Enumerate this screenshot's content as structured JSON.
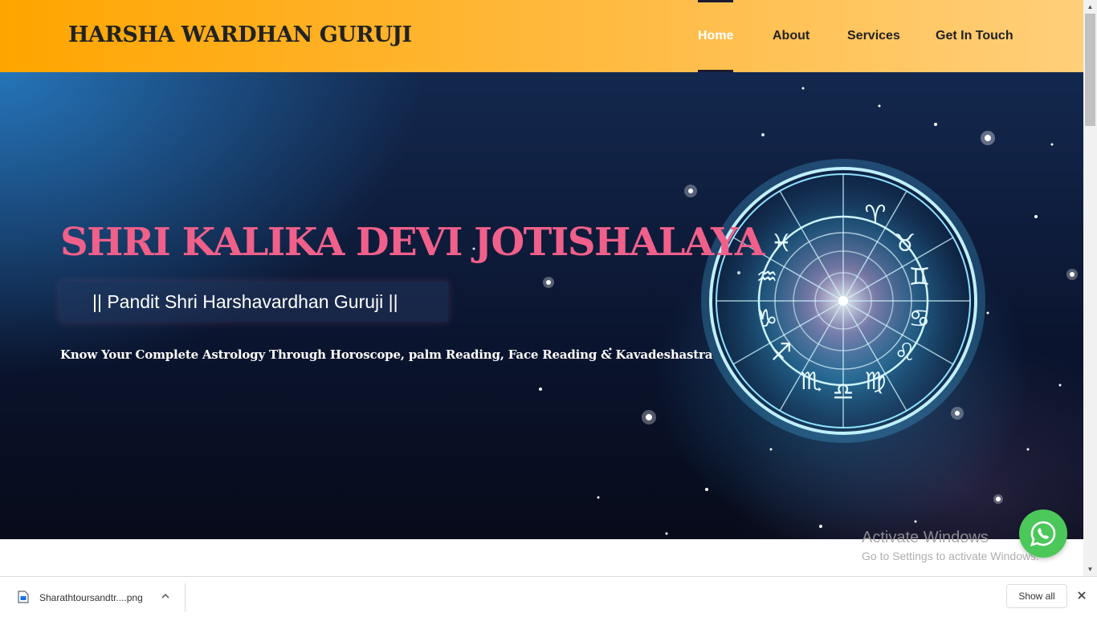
{
  "header": {
    "site_title": "HARSHA WARDHAN GURUJI",
    "nav": [
      "Home",
      "About",
      "Services",
      "Get In Touch"
    ],
    "active_nav": "Home"
  },
  "hero": {
    "title": "SHRI KALIKA DEVI JOTISHALAYA",
    "subtitle": "|| Pandit Shri Harshavardhan Guruji ||",
    "description": "Know Your Complete Astrology Through Horoscope, palm Reading, Face Reading & Kavadeshastra"
  },
  "watermark": {
    "title": "Activate Windows",
    "subtitle": "Go to Settings to activate Windows."
  },
  "floating": {
    "icon": "whatsapp-icon"
  },
  "download_bar": {
    "file_name": "Sharathtoursandtr....png",
    "show_all": "Show all"
  },
  "colors": {
    "header_start": "#ffa500",
    "hero_title": "#f0608a",
    "whatsapp": "#4cc75a"
  }
}
